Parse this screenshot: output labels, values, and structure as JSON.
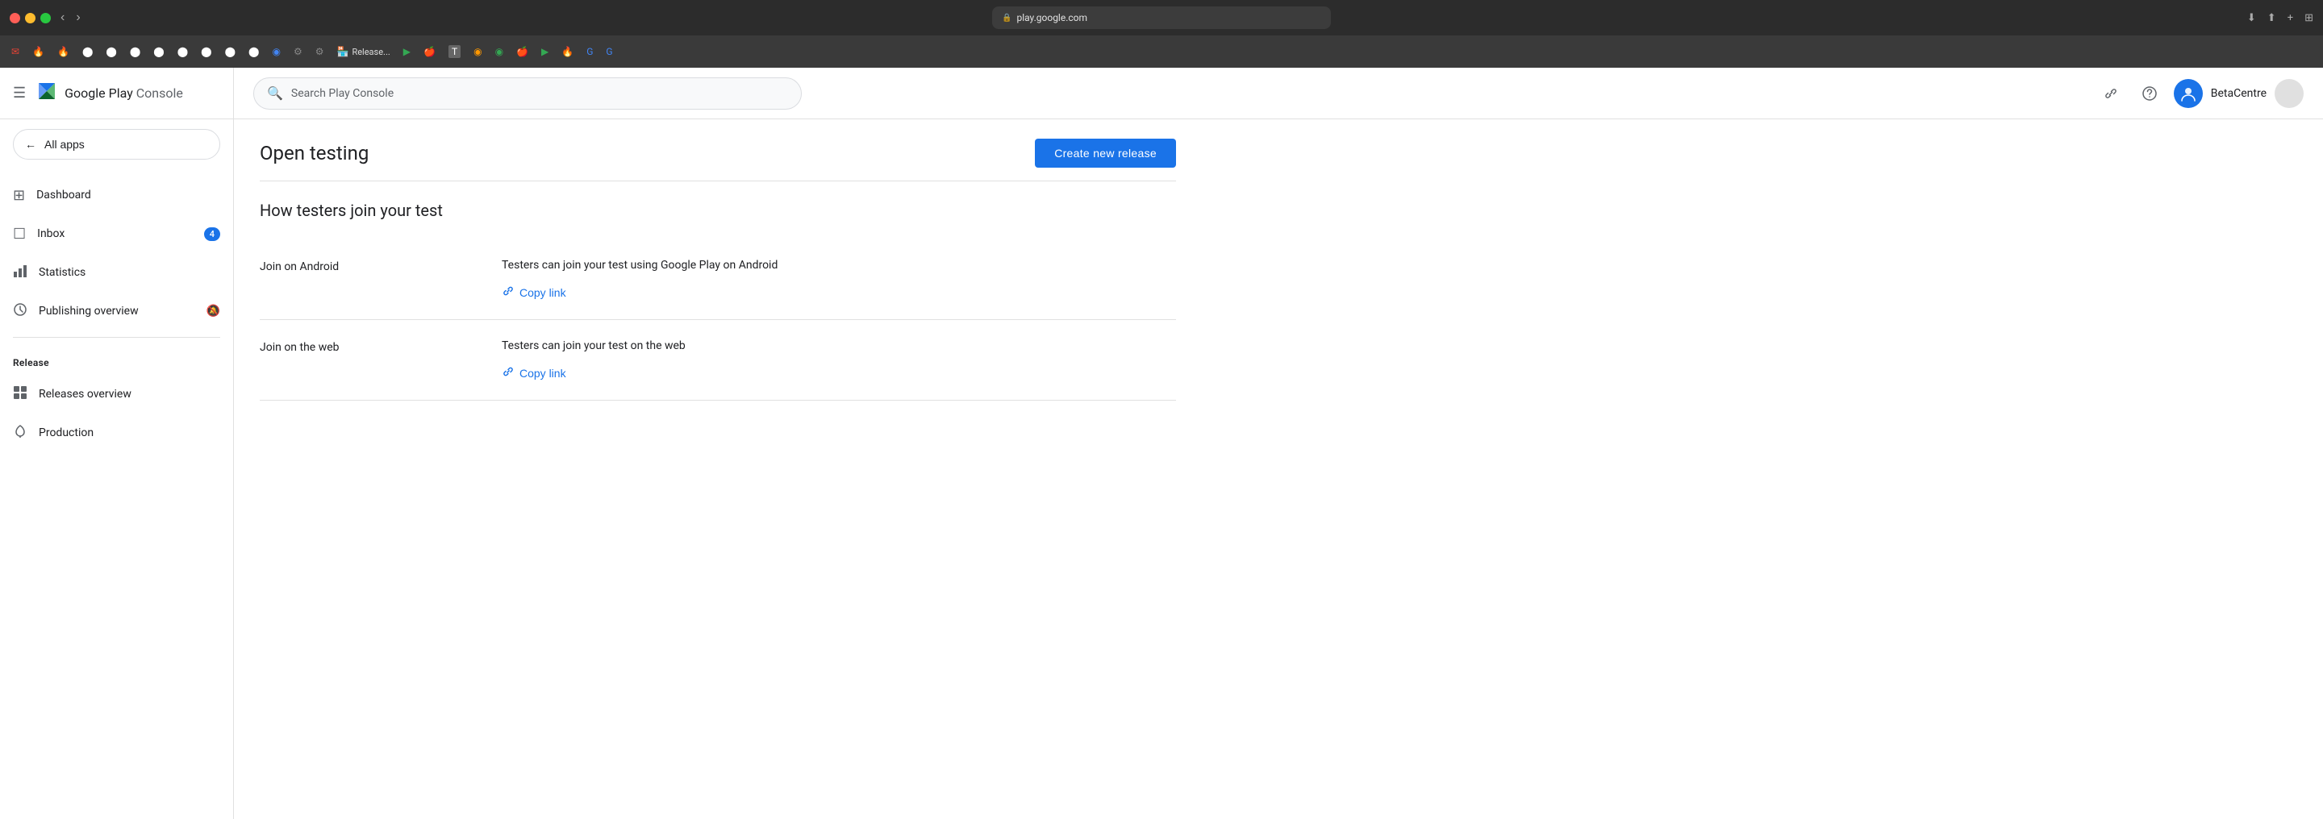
{
  "titlebar": {
    "url": "play.google.com",
    "lock_icon": "🔒"
  },
  "bookmarks": [
    {
      "icon": "✉",
      "label": "",
      "color": "#ea4335"
    },
    {
      "icon": "🔥",
      "label": ""
    },
    {
      "icon": "🔥",
      "label": ""
    },
    {
      "icon": "🐙",
      "label": ""
    },
    {
      "icon": "🐙",
      "label": ""
    },
    {
      "icon": "🐙",
      "label": ""
    },
    {
      "icon": "🐙",
      "label": ""
    },
    {
      "icon": "🐙",
      "label": ""
    },
    {
      "icon": "🐙",
      "label": ""
    },
    {
      "icon": "🐙",
      "label": ""
    },
    {
      "icon": "🐙",
      "label": ""
    },
    {
      "icon": "🔵",
      "label": ""
    },
    {
      "icon": "⚙",
      "label": ""
    },
    {
      "icon": "⚙",
      "label": ""
    },
    {
      "icon": "🏪",
      "label": "Release..."
    },
    {
      "icon": "▶",
      "label": ""
    },
    {
      "icon": "🍎",
      "label": ""
    },
    {
      "icon": "T",
      "label": ""
    },
    {
      "icon": "🟠",
      "label": ""
    },
    {
      "icon": "🟢",
      "label": ""
    },
    {
      "icon": "🍎",
      "label": ""
    },
    {
      "icon": "▶",
      "label": ""
    },
    {
      "icon": "🔥",
      "label": ""
    },
    {
      "icon": "G",
      "label": ""
    },
    {
      "icon": "G",
      "label": ""
    }
  ],
  "sidebar": {
    "logo_text": "Google Play",
    "logo_subtext": "Console",
    "all_apps_label": "All apps",
    "nav_items": [
      {
        "icon": "⊞",
        "label": "Dashboard",
        "active": false,
        "badge": null
      },
      {
        "icon": "☐",
        "label": "Inbox",
        "active": false,
        "badge": "4"
      },
      {
        "icon": "📊",
        "label": "Statistics",
        "active": false,
        "badge": null
      },
      {
        "icon": "🕐",
        "label": "Publishing overview",
        "active": false,
        "badge": null,
        "extra_icon": "🔕"
      }
    ],
    "release_section_title": "Release",
    "release_items": [
      {
        "icon": "⊞",
        "label": "Releases overview",
        "active": false
      },
      {
        "icon": "🔔",
        "label": "Production",
        "active": false
      }
    ]
  },
  "topbar": {
    "search_placeholder": "Search Play Console",
    "user_name": "BetaCentre"
  },
  "page": {
    "title": "Open testing",
    "create_button": "Create new release",
    "section_title": "How testers join your test",
    "join_rows": [
      {
        "label": "Join on Android",
        "description": "Testers can join your test using Google Play on Android",
        "copy_link_label": "Copy link"
      },
      {
        "label": "Join on the web",
        "description": "Testers can join your test on the web",
        "copy_link_label": "Copy link"
      }
    ]
  }
}
